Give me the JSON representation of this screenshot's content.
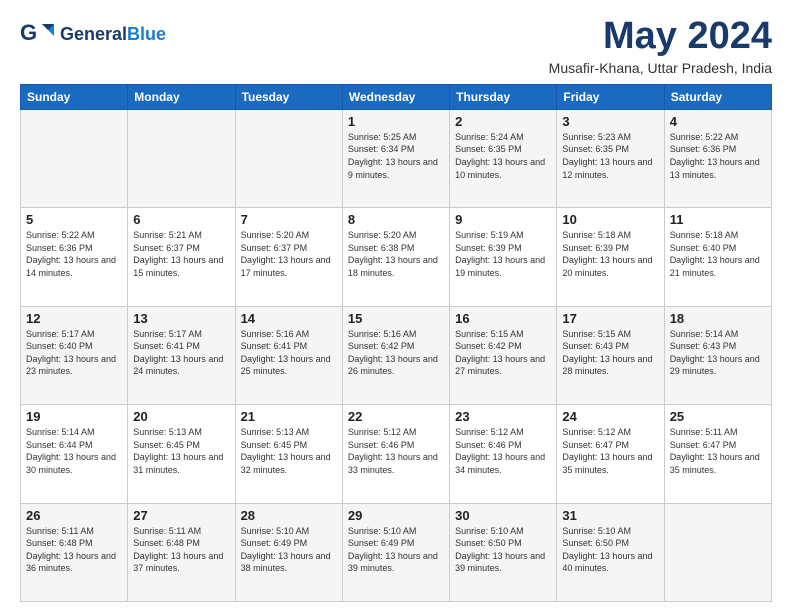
{
  "header": {
    "logo_general": "General",
    "logo_blue": "Blue",
    "title": "May 2024",
    "location": "Musafir-Khana, Uttar Pradesh, India"
  },
  "days_of_week": [
    "Sunday",
    "Monday",
    "Tuesday",
    "Wednesday",
    "Thursday",
    "Friday",
    "Saturday"
  ],
  "weeks": [
    [
      {
        "day": "",
        "sunrise": "",
        "sunset": "",
        "daylight": ""
      },
      {
        "day": "",
        "sunrise": "",
        "sunset": "",
        "daylight": ""
      },
      {
        "day": "",
        "sunrise": "",
        "sunset": "",
        "daylight": ""
      },
      {
        "day": "1",
        "sunrise": "Sunrise: 5:25 AM",
        "sunset": "Sunset: 6:34 PM",
        "daylight": "Daylight: 13 hours and 9 minutes."
      },
      {
        "day": "2",
        "sunrise": "Sunrise: 5:24 AM",
        "sunset": "Sunset: 6:35 PM",
        "daylight": "Daylight: 13 hours and 10 minutes."
      },
      {
        "day": "3",
        "sunrise": "Sunrise: 5:23 AM",
        "sunset": "Sunset: 6:35 PM",
        "daylight": "Daylight: 13 hours and 12 minutes."
      },
      {
        "day": "4",
        "sunrise": "Sunrise: 5:22 AM",
        "sunset": "Sunset: 6:36 PM",
        "daylight": "Daylight: 13 hours and 13 minutes."
      }
    ],
    [
      {
        "day": "5",
        "sunrise": "Sunrise: 5:22 AM",
        "sunset": "Sunset: 6:36 PM",
        "daylight": "Daylight: 13 hours and 14 minutes."
      },
      {
        "day": "6",
        "sunrise": "Sunrise: 5:21 AM",
        "sunset": "Sunset: 6:37 PM",
        "daylight": "Daylight: 13 hours and 15 minutes."
      },
      {
        "day": "7",
        "sunrise": "Sunrise: 5:20 AM",
        "sunset": "Sunset: 6:37 PM",
        "daylight": "Daylight: 13 hours and 17 minutes."
      },
      {
        "day": "8",
        "sunrise": "Sunrise: 5:20 AM",
        "sunset": "Sunset: 6:38 PM",
        "daylight": "Daylight: 13 hours and 18 minutes."
      },
      {
        "day": "9",
        "sunrise": "Sunrise: 5:19 AM",
        "sunset": "Sunset: 6:39 PM",
        "daylight": "Daylight: 13 hours and 19 minutes."
      },
      {
        "day": "10",
        "sunrise": "Sunrise: 5:18 AM",
        "sunset": "Sunset: 6:39 PM",
        "daylight": "Daylight: 13 hours and 20 minutes."
      },
      {
        "day": "11",
        "sunrise": "Sunrise: 5:18 AM",
        "sunset": "Sunset: 6:40 PM",
        "daylight": "Daylight: 13 hours and 21 minutes."
      }
    ],
    [
      {
        "day": "12",
        "sunrise": "Sunrise: 5:17 AM",
        "sunset": "Sunset: 6:40 PM",
        "daylight": "Daylight: 13 hours and 23 minutes."
      },
      {
        "day": "13",
        "sunrise": "Sunrise: 5:17 AM",
        "sunset": "Sunset: 6:41 PM",
        "daylight": "Daylight: 13 hours and 24 minutes."
      },
      {
        "day": "14",
        "sunrise": "Sunrise: 5:16 AM",
        "sunset": "Sunset: 6:41 PM",
        "daylight": "Daylight: 13 hours and 25 minutes."
      },
      {
        "day": "15",
        "sunrise": "Sunrise: 5:16 AM",
        "sunset": "Sunset: 6:42 PM",
        "daylight": "Daylight: 13 hours and 26 minutes."
      },
      {
        "day": "16",
        "sunrise": "Sunrise: 5:15 AM",
        "sunset": "Sunset: 6:42 PM",
        "daylight": "Daylight: 13 hours and 27 minutes."
      },
      {
        "day": "17",
        "sunrise": "Sunrise: 5:15 AM",
        "sunset": "Sunset: 6:43 PM",
        "daylight": "Daylight: 13 hours and 28 minutes."
      },
      {
        "day": "18",
        "sunrise": "Sunrise: 5:14 AM",
        "sunset": "Sunset: 6:43 PM",
        "daylight": "Daylight: 13 hours and 29 minutes."
      }
    ],
    [
      {
        "day": "19",
        "sunrise": "Sunrise: 5:14 AM",
        "sunset": "Sunset: 6:44 PM",
        "daylight": "Daylight: 13 hours and 30 minutes."
      },
      {
        "day": "20",
        "sunrise": "Sunrise: 5:13 AM",
        "sunset": "Sunset: 6:45 PM",
        "daylight": "Daylight: 13 hours and 31 minutes."
      },
      {
        "day": "21",
        "sunrise": "Sunrise: 5:13 AM",
        "sunset": "Sunset: 6:45 PM",
        "daylight": "Daylight: 13 hours and 32 minutes."
      },
      {
        "day": "22",
        "sunrise": "Sunrise: 5:12 AM",
        "sunset": "Sunset: 6:46 PM",
        "daylight": "Daylight: 13 hours and 33 minutes."
      },
      {
        "day": "23",
        "sunrise": "Sunrise: 5:12 AM",
        "sunset": "Sunset: 6:46 PM",
        "daylight": "Daylight: 13 hours and 34 minutes."
      },
      {
        "day": "24",
        "sunrise": "Sunrise: 5:12 AM",
        "sunset": "Sunset: 6:47 PM",
        "daylight": "Daylight: 13 hours and 35 minutes."
      },
      {
        "day": "25",
        "sunrise": "Sunrise: 5:11 AM",
        "sunset": "Sunset: 6:47 PM",
        "daylight": "Daylight: 13 hours and 35 minutes."
      }
    ],
    [
      {
        "day": "26",
        "sunrise": "Sunrise: 5:11 AM",
        "sunset": "Sunset: 6:48 PM",
        "daylight": "Daylight: 13 hours and 36 minutes."
      },
      {
        "day": "27",
        "sunrise": "Sunrise: 5:11 AM",
        "sunset": "Sunset: 6:48 PM",
        "daylight": "Daylight: 13 hours and 37 minutes."
      },
      {
        "day": "28",
        "sunrise": "Sunrise: 5:10 AM",
        "sunset": "Sunset: 6:49 PM",
        "daylight": "Daylight: 13 hours and 38 minutes."
      },
      {
        "day": "29",
        "sunrise": "Sunrise: 5:10 AM",
        "sunset": "Sunset: 6:49 PM",
        "daylight": "Daylight: 13 hours and 39 minutes."
      },
      {
        "day": "30",
        "sunrise": "Sunrise: 5:10 AM",
        "sunset": "Sunset: 6:50 PM",
        "daylight": "Daylight: 13 hours and 39 minutes."
      },
      {
        "day": "31",
        "sunrise": "Sunrise: 5:10 AM",
        "sunset": "Sunset: 6:50 PM",
        "daylight": "Daylight: 13 hours and 40 minutes."
      },
      {
        "day": "",
        "sunrise": "",
        "sunset": "",
        "daylight": ""
      }
    ]
  ]
}
